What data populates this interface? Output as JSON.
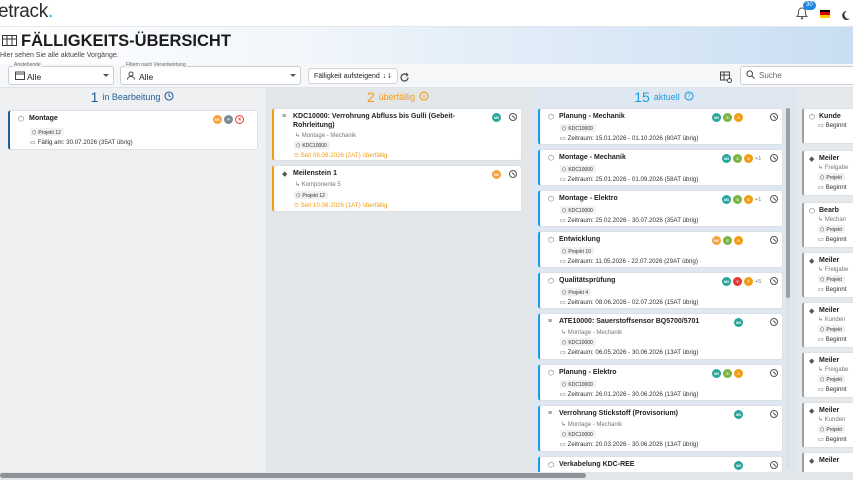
{
  "app": {
    "logo": "etrack",
    "logo_dot": ".",
    "notification_count": "30"
  },
  "header": {
    "title": "FÄLLIGKEITS-ÜBERSICHT",
    "subtitle": "Hier sehen Sie alle aktuelle Vorgänge."
  },
  "filters": {
    "anstehende": {
      "label": "Anstehende",
      "value": "Alle"
    },
    "verantwortung": {
      "label": "Filtern nach Verantwortung",
      "value": "Alle"
    },
    "sort_label": "Fälligkeit aufsteigend",
    "search_placeholder": "Suche"
  },
  "columns": {
    "in_bearbeitung": {
      "count": "1",
      "label": "in Bearbeitung",
      "color": "#1f5f99"
    },
    "ueberfaellig": {
      "count": "2",
      "label": "überfällig",
      "color": "#f39c12"
    },
    "aktuell": {
      "count": "15",
      "label": "aktuell",
      "color": "#1e9be0"
    }
  },
  "cards_col1": [
    {
      "title": "Montage",
      "chip": "Projekt 12",
      "due": "Fällig am: 30.07.2026 (35AT übrig)",
      "avatars": [
        {
          "t": "NK",
          "c": "#f7a13b"
        },
        {
          "t": "P",
          "c": "#7b8a97"
        },
        {
          "t": "",
          "c": "#ffffff"
        }
      ]
    }
  ],
  "cards_col2": [
    {
      "title": "KDC10000: Verrohrung Abfluss bis Gulli (Gebeit-Rohrleitung)",
      "sub": "Montage - Mechanik",
      "chip": "KDC10000",
      "due": "Seit 08.06.2026 (2AT) überfällig"
    },
    {
      "title": "Meilenstein 1",
      "sub": "Komponente 5",
      "chip": "Projekt 12",
      "due": "Seit 10.06.2026 (1AT) überfällig"
    }
  ],
  "cards_col3": [
    {
      "title": "Planung - Mechanik",
      "chip": "KDC10000",
      "due": "Zeitraum: 15.01.2026 - 01.10.2026 (80AT übrig)",
      "avatars": [
        "M3",
        "S",
        "S"
      ],
      "plus": ""
    },
    {
      "title": "Montage - Mechanik",
      "chip": "KDC10000",
      "due": "Zeitraum: 25.01.2026 - 01.09.2026 (58AT übrig)",
      "avatars": [
        "M3",
        "S",
        "S"
      ],
      "plus": "+1"
    },
    {
      "title": "Montage - Elektro",
      "chip": "KDC10000",
      "due": "Zeitraum: 25.02.2026 - 30.07.2026 (35AT übrig)",
      "avatars": [
        "M3",
        "S",
        "S"
      ],
      "plus": "+1"
    },
    {
      "title": "Entwicklung",
      "chip": "Projekt 10",
      "due": "Zeitraum: 11.05.2026 - 22.07.2026 (29AT übrig)",
      "avatars": [
        "NK",
        "S",
        "S"
      ],
      "plus": ""
    },
    {
      "title": "Qualitätsprüfung",
      "chip": "Projekt 4",
      "due": "Zeitraum: 08.06.2026 - 02.07.2026 (15AT übrig)",
      "avatars": [
        "M3",
        "V",
        "T"
      ],
      "plus": "+5"
    },
    {
      "title": "ATE10000: Sauerstoffsensor BQ5700/5701",
      "sub": "Montage - Mechanik",
      "chip": "KDC10000",
      "due": "Zeitraum: 06.05.2026 - 30.06.2026 (13AT übrig)",
      "avatars": [
        "M3"
      ],
      "plus": ""
    },
    {
      "title": "Planung - Elektro",
      "chip": "KDC10000",
      "due": "Zeitraum: 26.01.2026 - 30.06.2026 (13AT übrig)",
      "avatars": [
        "M3",
        "S",
        "S"
      ],
      "plus": ""
    },
    {
      "title": "Verrohrung Stickstoff (Provisorium)",
      "sub": "Montage - Mechanik",
      "chip": "KDC10000",
      "due": "Zeitraum: 20.03.2026 - 30.06.2026 (13AT übrig)",
      "avatars": [
        "M3"
      ],
      "plus": ""
    },
    {
      "title": "Verkabelung KDC-REE",
      "chip": "",
      "due": "",
      "avatars": [
        "M3"
      ],
      "plus": ""
    }
  ],
  "cards_col4": [
    {
      "title": "Kunde",
      "line2": "Beginnt"
    },
    {
      "title": "Meiler",
      "line1": "Freigabe",
      "chip": "Projekt",
      "line2": "Beginnt"
    },
    {
      "title": "Bearb",
      "line1": "Mechan",
      "chip": "Projekt",
      "line2": "Beginnt"
    },
    {
      "title": "Meiler",
      "line1": "Freigabe",
      "chip": "Projekt",
      "line2": "Beginnt"
    },
    {
      "title": "Meiler",
      "line1": "Kunden",
      "chip": "Projekt",
      "line2": "Beginnt"
    },
    {
      "title": "Meiler",
      "line1": "Freigabe",
      "chip": "Projekt",
      "line2": "Beginnt"
    },
    {
      "title": "Meiler",
      "line1": "Kunden",
      "chip": "Projekt",
      "line2": "Beginnt"
    },
    {
      "title": "Meiler",
      "line1": ""
    }
  ],
  "colors": {
    "in_bearbeitung": "#1f5f99",
    "ueberfaellig": "#f39c12",
    "aktuell": "#1e9be0",
    "m3": "#26a69a",
    "s_orange": "#f39c12",
    "s_green": "#7cb342"
  }
}
